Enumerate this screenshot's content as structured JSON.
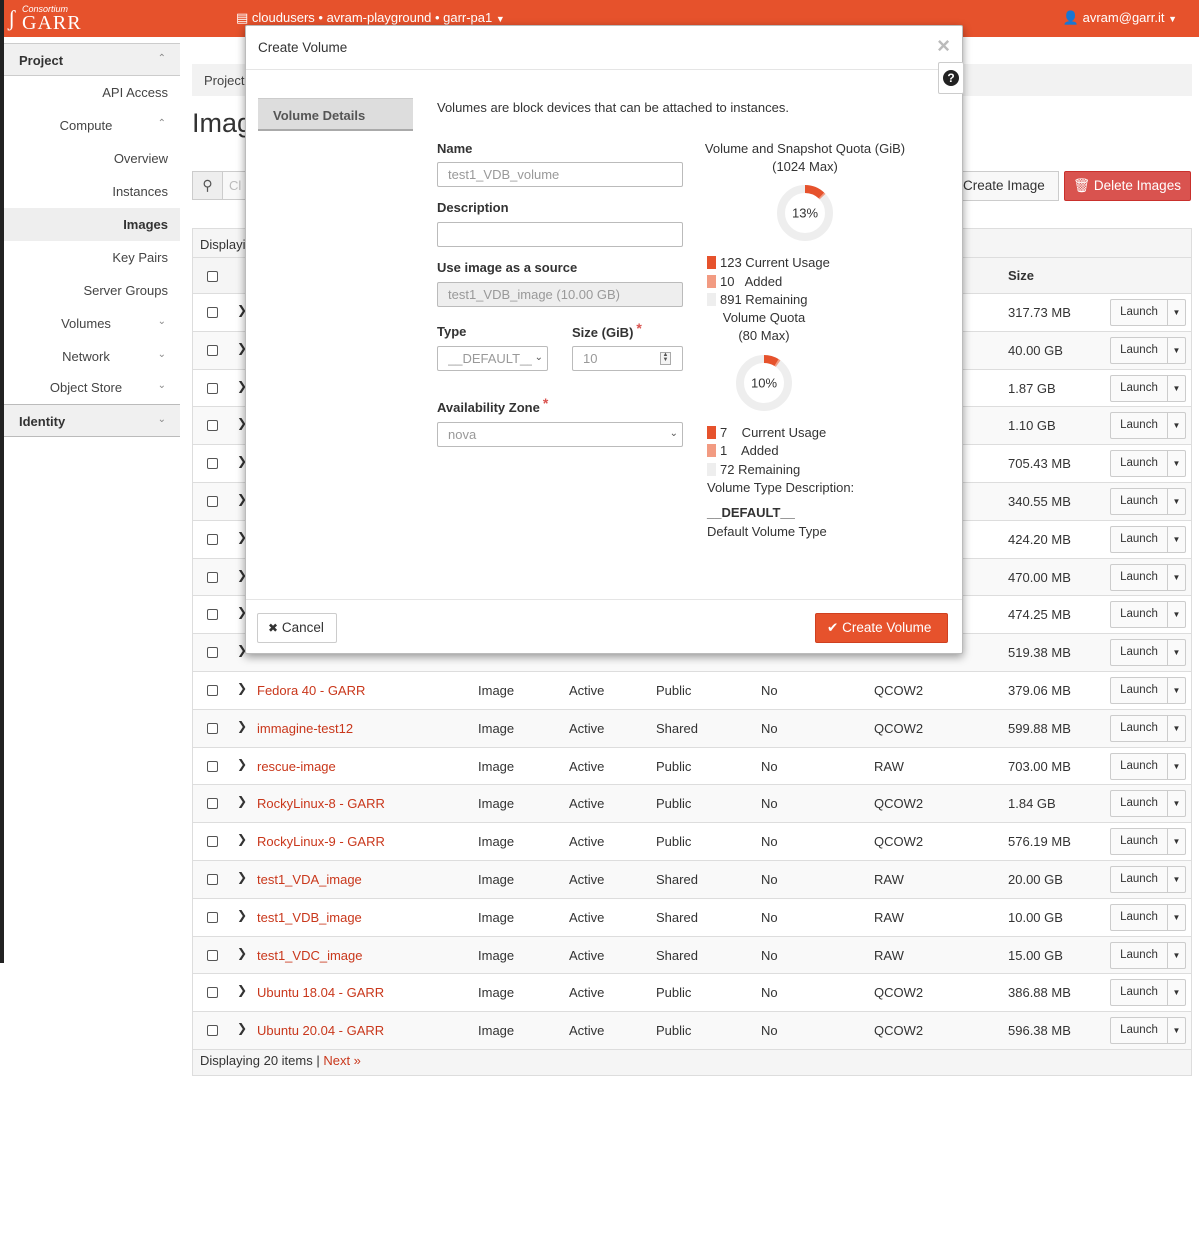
{
  "topbar": {
    "logo_small": "Consortium",
    "logo_big": "GARR",
    "project_context": "cloudusers • avram-playground • garr-pa1",
    "user": "avram@garr.it"
  },
  "sidebar": {
    "project": "Project",
    "api_access": "API Access",
    "compute": "Compute",
    "overview": "Overview",
    "instances": "Instances",
    "images": "Images",
    "key_pairs": "Key Pairs",
    "server_groups": "Server Groups",
    "volumes": "Volumes",
    "network": "Network",
    "object_store": "Object Store",
    "identity": "Identity"
  },
  "page": {
    "breadcrumb": "Project",
    "title": "Imag",
    "search_placeholder": "Cl",
    "create_image": "Create Image",
    "delete_images": "Delete Images",
    "displaying_top": "Displayi",
    "col_size": "Size",
    "footer_displaying": "Displaying 20 items | ",
    "footer_next": "Next »",
    "launch_label": "Launch"
  },
  "rows": [
    {
      "name": "",
      "type": "",
      "status": "",
      "visibility": "",
      "protected": "",
      "format": "",
      "size": "317.73 MB"
    },
    {
      "name": "",
      "type": "",
      "status": "",
      "visibility": "",
      "protected": "",
      "format": "",
      "size": "40.00 GB"
    },
    {
      "name": "",
      "type": "",
      "status": "",
      "visibility": "",
      "protected": "",
      "format": "",
      "size": "1.87 GB"
    },
    {
      "name": "",
      "type": "",
      "status": "",
      "visibility": "",
      "protected": "",
      "format": "",
      "size": "1.10 GB"
    },
    {
      "name": "",
      "type": "",
      "status": "",
      "visibility": "",
      "protected": "",
      "format": "",
      "size": "705.43 MB"
    },
    {
      "name": "",
      "type": "",
      "status": "",
      "visibility": "",
      "protected": "",
      "format": "",
      "size": "340.55 MB"
    },
    {
      "name": "",
      "type": "",
      "status": "",
      "visibility": "",
      "protected": "",
      "format": "",
      "size": "424.20 MB"
    },
    {
      "name": "",
      "type": "",
      "status": "",
      "visibility": "",
      "protected": "",
      "format": "",
      "size": "470.00 MB"
    },
    {
      "name": "",
      "type": "",
      "status": "",
      "visibility": "",
      "protected": "",
      "format": "",
      "size": "474.25 MB"
    },
    {
      "name": "",
      "type": "",
      "status": "",
      "visibility": "",
      "protected": "",
      "format": "",
      "size": "519.38 MB"
    },
    {
      "name": "Fedora 40 - GARR",
      "type": "Image",
      "status": "Active",
      "visibility": "Public",
      "protected": "No",
      "format": "QCOW2",
      "size": "379.06 MB"
    },
    {
      "name": "immagine-test12",
      "type": "Image",
      "status": "Active",
      "visibility": "Shared",
      "protected": "No",
      "format": "QCOW2",
      "size": "599.88 MB"
    },
    {
      "name": "rescue-image",
      "type": "Image",
      "status": "Active",
      "visibility": "Public",
      "protected": "No",
      "format": "RAW",
      "size": "703.00 MB"
    },
    {
      "name": "RockyLinux-8 - GARR",
      "type": "Image",
      "status": "Active",
      "visibility": "Public",
      "protected": "No",
      "format": "QCOW2",
      "size": "1.84 GB"
    },
    {
      "name": "RockyLinux-9 - GARR",
      "type": "Image",
      "status": "Active",
      "visibility": "Public",
      "protected": "No",
      "format": "QCOW2",
      "size": "576.19 MB"
    },
    {
      "name": "test1_VDA_image",
      "type": "Image",
      "status": "Active",
      "visibility": "Shared",
      "protected": "No",
      "format": "RAW",
      "size": "20.00 GB"
    },
    {
      "name": "test1_VDB_image",
      "type": "Image",
      "status": "Active",
      "visibility": "Shared",
      "protected": "No",
      "format": "RAW",
      "size": "10.00 GB"
    },
    {
      "name": "test1_VDC_image",
      "type": "Image",
      "status": "Active",
      "visibility": "Shared",
      "protected": "No",
      "format": "RAW",
      "size": "15.00 GB"
    },
    {
      "name": "Ubuntu 18.04 - GARR",
      "type": "Image",
      "status": "Active",
      "visibility": "Public",
      "protected": "No",
      "format": "QCOW2",
      "size": "386.88 MB"
    },
    {
      "name": "Ubuntu 20.04 - GARR",
      "type": "Image",
      "status": "Active",
      "visibility": "Public",
      "protected": "No",
      "format": "QCOW2",
      "size": "596.38 MB"
    }
  ],
  "modal": {
    "title": "Create Volume",
    "close": "×",
    "help": "?",
    "tab_volume_details": "Volume Details",
    "intro": "Volumes are block devices that can be attached to instances.",
    "name_label": "Name",
    "name_value": "test1_VDB_volume",
    "description_label": "Description",
    "description_value": "",
    "source_label": "Use image as a source",
    "source_value": "test1_VDB_image (10.00 GB)",
    "type_label": "Type",
    "type_value": "__DEFAULT__",
    "size_label": "Size (GiB)",
    "size_value": "10",
    "required_mark": "*",
    "az_label": "Availability Zone",
    "az_value": "nova",
    "cancel": "Cancel",
    "create": "Create Volume",
    "accent_color": "#e6522c",
    "added_color": "#f29b82",
    "remaining_color": "#eeeeee"
  },
  "quota": {
    "snap_title": "Volume and Snapshot Quota (GiB)",
    "snap_max": "(1024 Max)",
    "snap_percent_label": "13%",
    "snap_current_fraction": 0.12,
    "snap_added_fraction": 0.01,
    "snap_current": "123 Current Usage",
    "snap_added": "10   Added",
    "snap_remaining": "891 Remaining",
    "vol_title": "Volume Quota",
    "vol_max": "(80 Max)",
    "vol_percent_label": "10%",
    "vol_current_fraction": 0.0875,
    "vol_added_fraction": 0.0125,
    "vol_current": "7    Current Usage",
    "vol_added": "1    Added",
    "vol_remaining": "72 Remaining",
    "vt_desc_label": "Volume Type Description:",
    "vt_name": "__DEFAULT__",
    "vt_desc": "Default Volume Type"
  }
}
